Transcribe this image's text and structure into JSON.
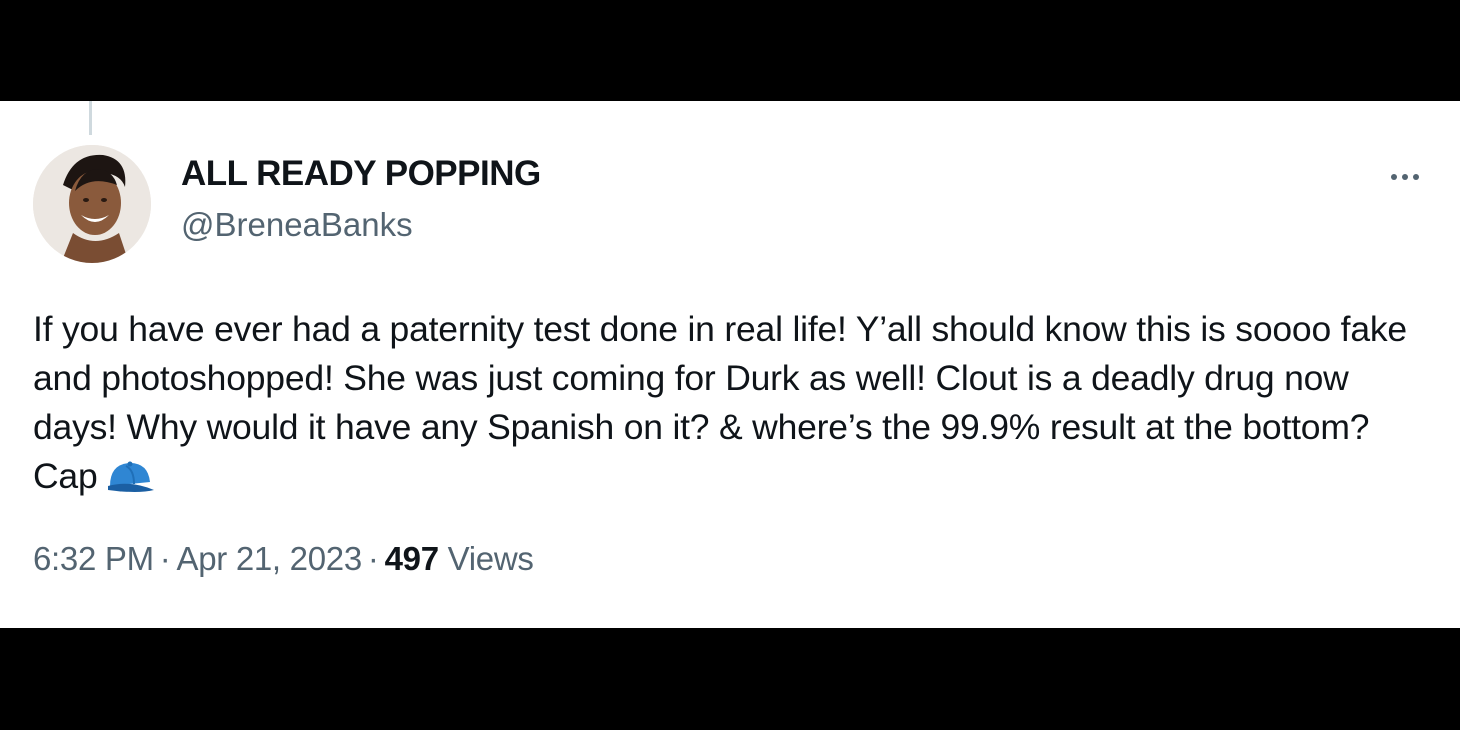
{
  "tweet": {
    "author_name": "ALL READY POPPING",
    "author_handle": "@BreneaBanks",
    "text": "If you have ever had a paternity test done in real life! Y’all should know this is soooo fake and photoshopped! She was just coming for Durk as well! Clout is a deadly drug now days! Why would it have any Spanish on it? & where’s the 99.9% result at the bottom? Cap",
    "emoji": "blue-cap-emoji",
    "time": "6:32 PM",
    "separator": "·",
    "date": "Apr 21, 2023",
    "views_count": "497",
    "views_label": "Views"
  },
  "icons": {
    "more": "more-horizontal-icon",
    "avatar": "profile-avatar"
  },
  "colors": {
    "card_background": "#ffffff",
    "frame_background": "#000000",
    "primary_text": "#0f1419",
    "secondary_text": "#536471",
    "thread_line": "#cfd9de",
    "cap_emoji": "#2f86d3"
  }
}
